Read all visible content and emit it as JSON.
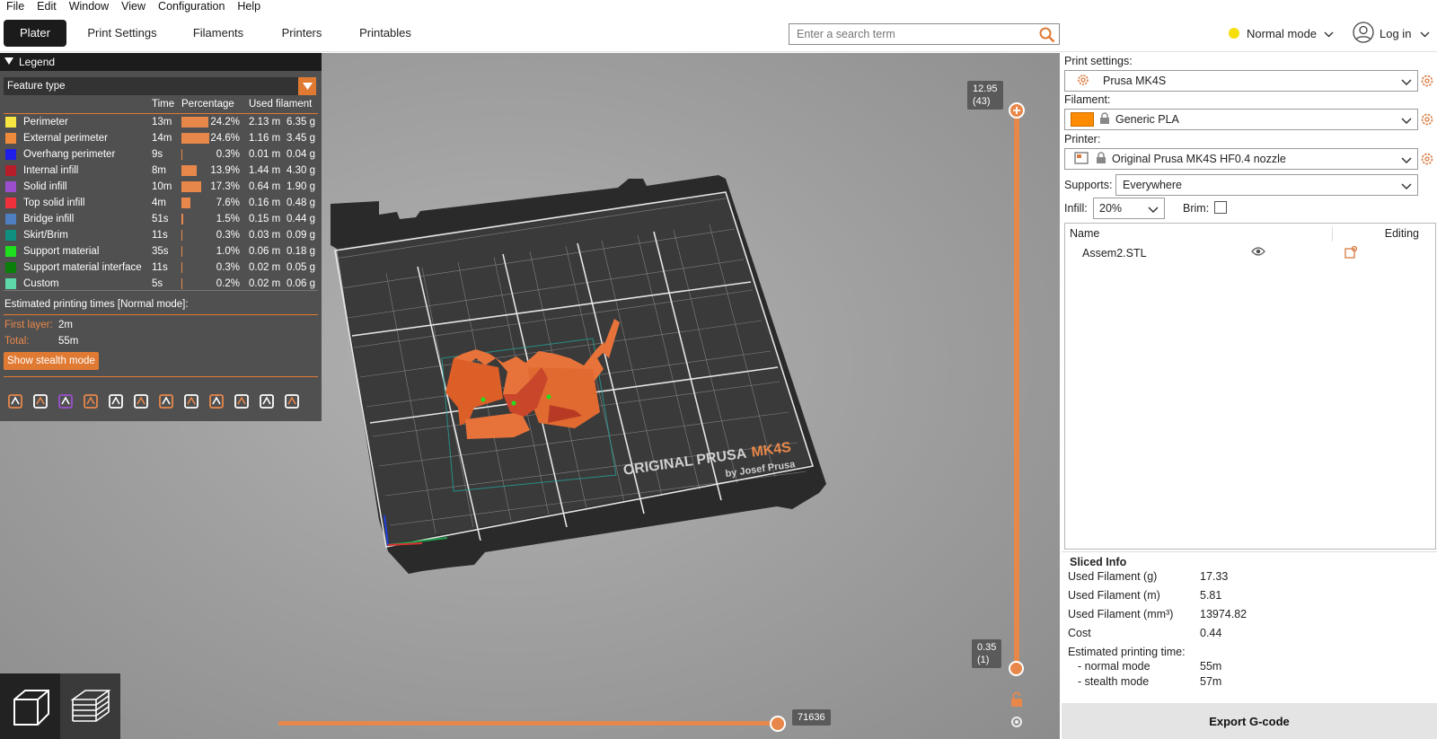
{
  "menu": [
    "File",
    "Edit",
    "Window",
    "View",
    "Configuration",
    "Help"
  ],
  "tabs": [
    "Plater",
    "Print Settings",
    "Filaments",
    "Printers",
    "Printables"
  ],
  "search": {
    "placeholder": "Enter a search term"
  },
  "mode": {
    "label": "Normal mode"
  },
  "login": {
    "label": "Log in"
  },
  "legend": {
    "title": "Legend",
    "feature_type": "Feature type",
    "columns": {
      "time": "Time",
      "percentage": "Percentage",
      "used": "Used filament"
    },
    "rows": [
      {
        "name": "Perimeter",
        "color": "#f5e642",
        "time": "13m",
        "pct": "24.2%",
        "pct_value": 24.2,
        "m": "2.13 m",
        "g": "6.35 g"
      },
      {
        "name": "External perimeter",
        "color": "#ef8a3a",
        "time": "14m",
        "pct": "24.6%",
        "pct_value": 24.6,
        "m": "1.16 m",
        "g": "3.45 g"
      },
      {
        "name": "Overhang perimeter",
        "color": "#1e1ee8",
        "time": "9s",
        "pct": "0.3%",
        "pct_value": 0.3,
        "m": "0.01 m",
        "g": "0.04 g"
      },
      {
        "name": "Internal infill",
        "color": "#b81e2a",
        "time": "8m",
        "pct": "13.9%",
        "pct_value": 13.9,
        "m": "1.44 m",
        "g": "4.30 g"
      },
      {
        "name": "Solid infill",
        "color": "#9b4fcf",
        "time": "10m",
        "pct": "17.3%",
        "pct_value": 17.3,
        "m": "0.64 m",
        "g": "1.90 g"
      },
      {
        "name": "Top solid infill",
        "color": "#f0303a",
        "time": "4m",
        "pct": "7.6%",
        "pct_value": 7.6,
        "m": "0.16 m",
        "g": "0.48 g"
      },
      {
        "name": "Bridge infill",
        "color": "#4f7fbf",
        "time": "51s",
        "pct": "1.5%",
        "pct_value": 1.5,
        "m": "0.15 m",
        "g": "0.44 g"
      },
      {
        "name": "Skirt/Brim",
        "color": "#0f8f7f",
        "time": "11s",
        "pct": "0.3%",
        "pct_value": 0.3,
        "m": "0.03 m",
        "g": "0.09 g"
      },
      {
        "name": "Support material",
        "color": "#1fe01f",
        "time": "35s",
        "pct": "1.0%",
        "pct_value": 1.0,
        "m": "0.06 m",
        "g": "0.18 g"
      },
      {
        "name": "Support material interface",
        "color": "#0a7f0a",
        "time": "11s",
        "pct": "0.3%",
        "pct_value": 0.3,
        "m": "0.02 m",
        "g": "0.05 g"
      },
      {
        "name": "Custom",
        "color": "#5ed8a8",
        "time": "5s",
        "pct": "0.2%",
        "pct_value": 0.2,
        "m": "0.02 m",
        "g": "0.06 g"
      }
    ],
    "est_title": "Estimated printing times [Normal mode]:",
    "first_layer_label": "First layer:",
    "first_layer": "2m",
    "total_label": "Total:",
    "total": "55m",
    "stealth_button": "Show stealth mode",
    "toolbar_icons": [
      "seam-icon",
      "tool-change-icon",
      "retraction-icon",
      "deretraction-icon",
      "wipe-icon",
      "pause-icon",
      "color-change-icon",
      "wait-icon",
      "custom-gcode-icon",
      "center-of-gravity-icon",
      "shells-icon",
      "tool-marker-icon"
    ]
  },
  "bed": {
    "brand": "ORIGINAL PRUSA",
    "model": "MK4S",
    "by": "by Josef Prusa"
  },
  "vslider": {
    "top_value": "12.95",
    "top_layer": "(43)",
    "bottom_value": "0.35",
    "bottom_layer": "(1)"
  },
  "hslider": {
    "value": "71636"
  },
  "panel": {
    "print_settings_label": "Print settings:",
    "print_settings": "Prusa MK4S",
    "filament_label": "Filament:",
    "filament": "Generic PLA",
    "filament_color": "#ff8c00",
    "printer_label": "Printer:",
    "printer": "Original Prusa MK4S HF0.4 nozzle",
    "supports_label": "Supports:",
    "supports": "Everywhere",
    "infill_label": "Infill:",
    "infill": "20%",
    "brim_label": "Brim:",
    "brim_checked": false,
    "list_col_name": "Name",
    "list_col_editing": "Editing",
    "object_name": "Assem2.STL"
  },
  "sliced": {
    "title": "Sliced Info",
    "rows": [
      {
        "label": "Used Filament (g)",
        "value": "17.33"
      },
      {
        "label": "Used Filament (m)",
        "value": "5.81"
      },
      {
        "label": "Used Filament (mm³)",
        "value": "13974.82"
      },
      {
        "label": "Cost",
        "value": "0.44"
      }
    ],
    "est_label": "Estimated printing time:",
    "normal_label": "- normal mode",
    "normal": "55m",
    "stealth_label": "- stealth mode",
    "stealth": "57m"
  },
  "export_button": "Export G-code"
}
